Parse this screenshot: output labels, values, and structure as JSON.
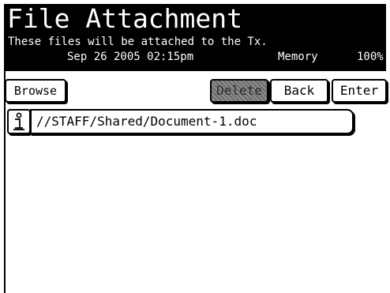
{
  "header": {
    "title": "File Attachment",
    "subtitle": "These files will be attached to the Tx.",
    "date": "Sep 26 2005 02:15pm",
    "memory_label": "Memory",
    "memory_percent": "100%"
  },
  "toolbar": {
    "browse_label": "Browse",
    "delete_label": "Delete",
    "back_label": "Back",
    "enter_label": "Enter"
  },
  "file_list": {
    "items": [
      {
        "icon": "info-icon",
        "path": "//STAFF/Shared/Document-1.doc"
      }
    ]
  },
  "colors": {
    "header_bg": "#000000",
    "header_text": "#ffffff",
    "disabled_button": "#7a7a7a"
  }
}
